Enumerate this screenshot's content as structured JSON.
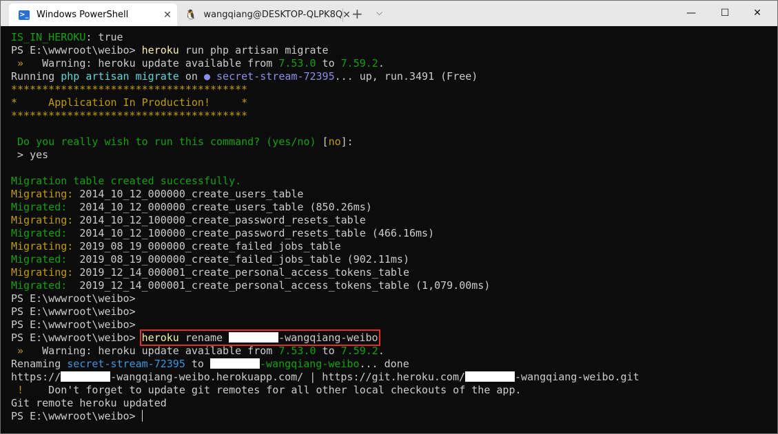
{
  "tabs": [
    {
      "label": "Windows PowerShell",
      "icon": "powershell-icon",
      "active": true
    },
    {
      "label": "wangqiang@DESKTOP-QLPK8Q",
      "icon": "linux-tux-icon",
      "active": false
    }
  ],
  "titlebar": {
    "new_tab": "+",
    "dropdown": "⌵",
    "minimize": "—",
    "maximize": "☐",
    "close": "✕",
    "tab_close": "✕"
  },
  "lines": [
    [
      {
        "t": "IS_IN_HEROKU",
        "c": "green"
      },
      {
        "t": ": true"
      }
    ],
    [
      {
        "t": "PS E:\\wwwroot\\weibo> "
      },
      {
        "t": "heroku",
        "c": "yellow"
      },
      {
        "t": " run php artisan migrate"
      }
    ],
    [
      {
        "t": " » ",
        "c": "gold"
      },
      {
        "t": "  Warning: heroku update available from "
      },
      {
        "t": "7.53.0",
        "c": "green"
      },
      {
        "t": " to "
      },
      {
        "t": "7.59.2",
        "c": "green"
      },
      {
        "t": "."
      }
    ],
    [
      {
        "t": "Running "
      },
      {
        "t": "php artisan migrate",
        "c": "cyan"
      },
      {
        "t": " on "
      },
      {
        "t": "● secret-stream-72395",
        "c": "purple"
      },
      {
        "t": "... up, run.3491 (Free)"
      }
    ],
    [
      {
        "t": "**************************************",
        "c": "gold"
      }
    ],
    [
      {
        "t": "*     Application In Production!     *",
        "c": "gold"
      }
    ],
    [
      {
        "t": "**************************************",
        "c": "gold"
      }
    ],
    [],
    [
      {
        "t": " Do you really wish to run this command? (yes/no) ",
        "c": "green"
      },
      {
        "t": "["
      },
      {
        "t": "no",
        "c": "gold"
      },
      {
        "t": "]:"
      }
    ],
    [
      {
        "t": " > yes"
      }
    ],
    [],
    [
      {
        "t": "Migration table created successfully.",
        "c": "green"
      }
    ],
    [
      {
        "t": "Migrating:",
        "c": "gold"
      },
      {
        "t": " 2014_10_12_000000_create_users_table"
      }
    ],
    [
      {
        "t": "Migrated: ",
        "c": "green"
      },
      {
        "t": " 2014_10_12_000000_create_users_table (850.26ms)"
      }
    ],
    [
      {
        "t": "Migrating:",
        "c": "gold"
      },
      {
        "t": " 2014_10_12_100000_create_password_resets_table"
      }
    ],
    [
      {
        "t": "Migrated: ",
        "c": "green"
      },
      {
        "t": " 2014_10_12_100000_create_password_resets_table (466.16ms)"
      }
    ],
    [
      {
        "t": "Migrating:",
        "c": "gold"
      },
      {
        "t": " 2019_08_19_000000_create_failed_jobs_table"
      }
    ],
    [
      {
        "t": "Migrated: ",
        "c": "green"
      },
      {
        "t": " 2019_08_19_000000_create_failed_jobs_table (902.11ms)"
      }
    ],
    [
      {
        "t": "Migrating:",
        "c": "gold"
      },
      {
        "t": " 2019_12_14_000001_create_personal_access_tokens_table"
      }
    ],
    [
      {
        "t": "Migrated: ",
        "c": "green"
      },
      {
        "t": " 2019_12_14_000001_create_personal_access_tokens_table (1,079.00ms)"
      }
    ],
    [
      {
        "t": "PS E:\\wwwroot\\weibo>"
      }
    ],
    [
      {
        "t": "PS E:\\wwwroot\\weibo>"
      }
    ],
    [
      {
        "t": "PS E:\\wwwroot\\weibo>"
      }
    ],
    [
      {
        "t": "PS E:\\wwwroot\\weibo> "
      },
      {
        "hl": true,
        "parts": [
          {
            "t": "heroku",
            "c": "yellow"
          },
          {
            "t": " rename "
          },
          {
            "redact": true
          },
          {
            "t": "-wangqiang-weibo"
          }
        ]
      }
    ],
    [
      {
        "t": " » ",
        "c": "gold"
      },
      {
        "t": "  Warning: heroku update available from "
      },
      {
        "t": "7.53.0",
        "c": "green"
      },
      {
        "t": " to "
      },
      {
        "t": "7.59.2",
        "c": "green"
      },
      {
        "t": "."
      }
    ],
    [
      {
        "t": "Renaming "
      },
      {
        "t": "secret-stream-72395",
        "c": "blue"
      },
      {
        "t": " to "
      },
      {
        "redact": true
      },
      {
        "t": "-wangqiang-weibo",
        "c": "green"
      },
      {
        "t": "... done"
      }
    ],
    [
      {
        "t": "https://"
      },
      {
        "redact": true
      },
      {
        "t": "-wangqiang-weibo.herokuapp.com/ | https://git.heroku.com/"
      },
      {
        "redact": true
      },
      {
        "t": "-wangqiang-weibo.git"
      }
    ],
    [
      {
        "t": " ! ",
        "c": "gold"
      },
      {
        "t": "   Don't forget to update git remotes for all other local checkouts of the app."
      }
    ],
    [
      {
        "t": "Git remote heroku updated"
      }
    ],
    [
      {
        "t": "PS E:\\wwwroot\\weibo> "
      },
      {
        "cursor": true
      }
    ]
  ]
}
